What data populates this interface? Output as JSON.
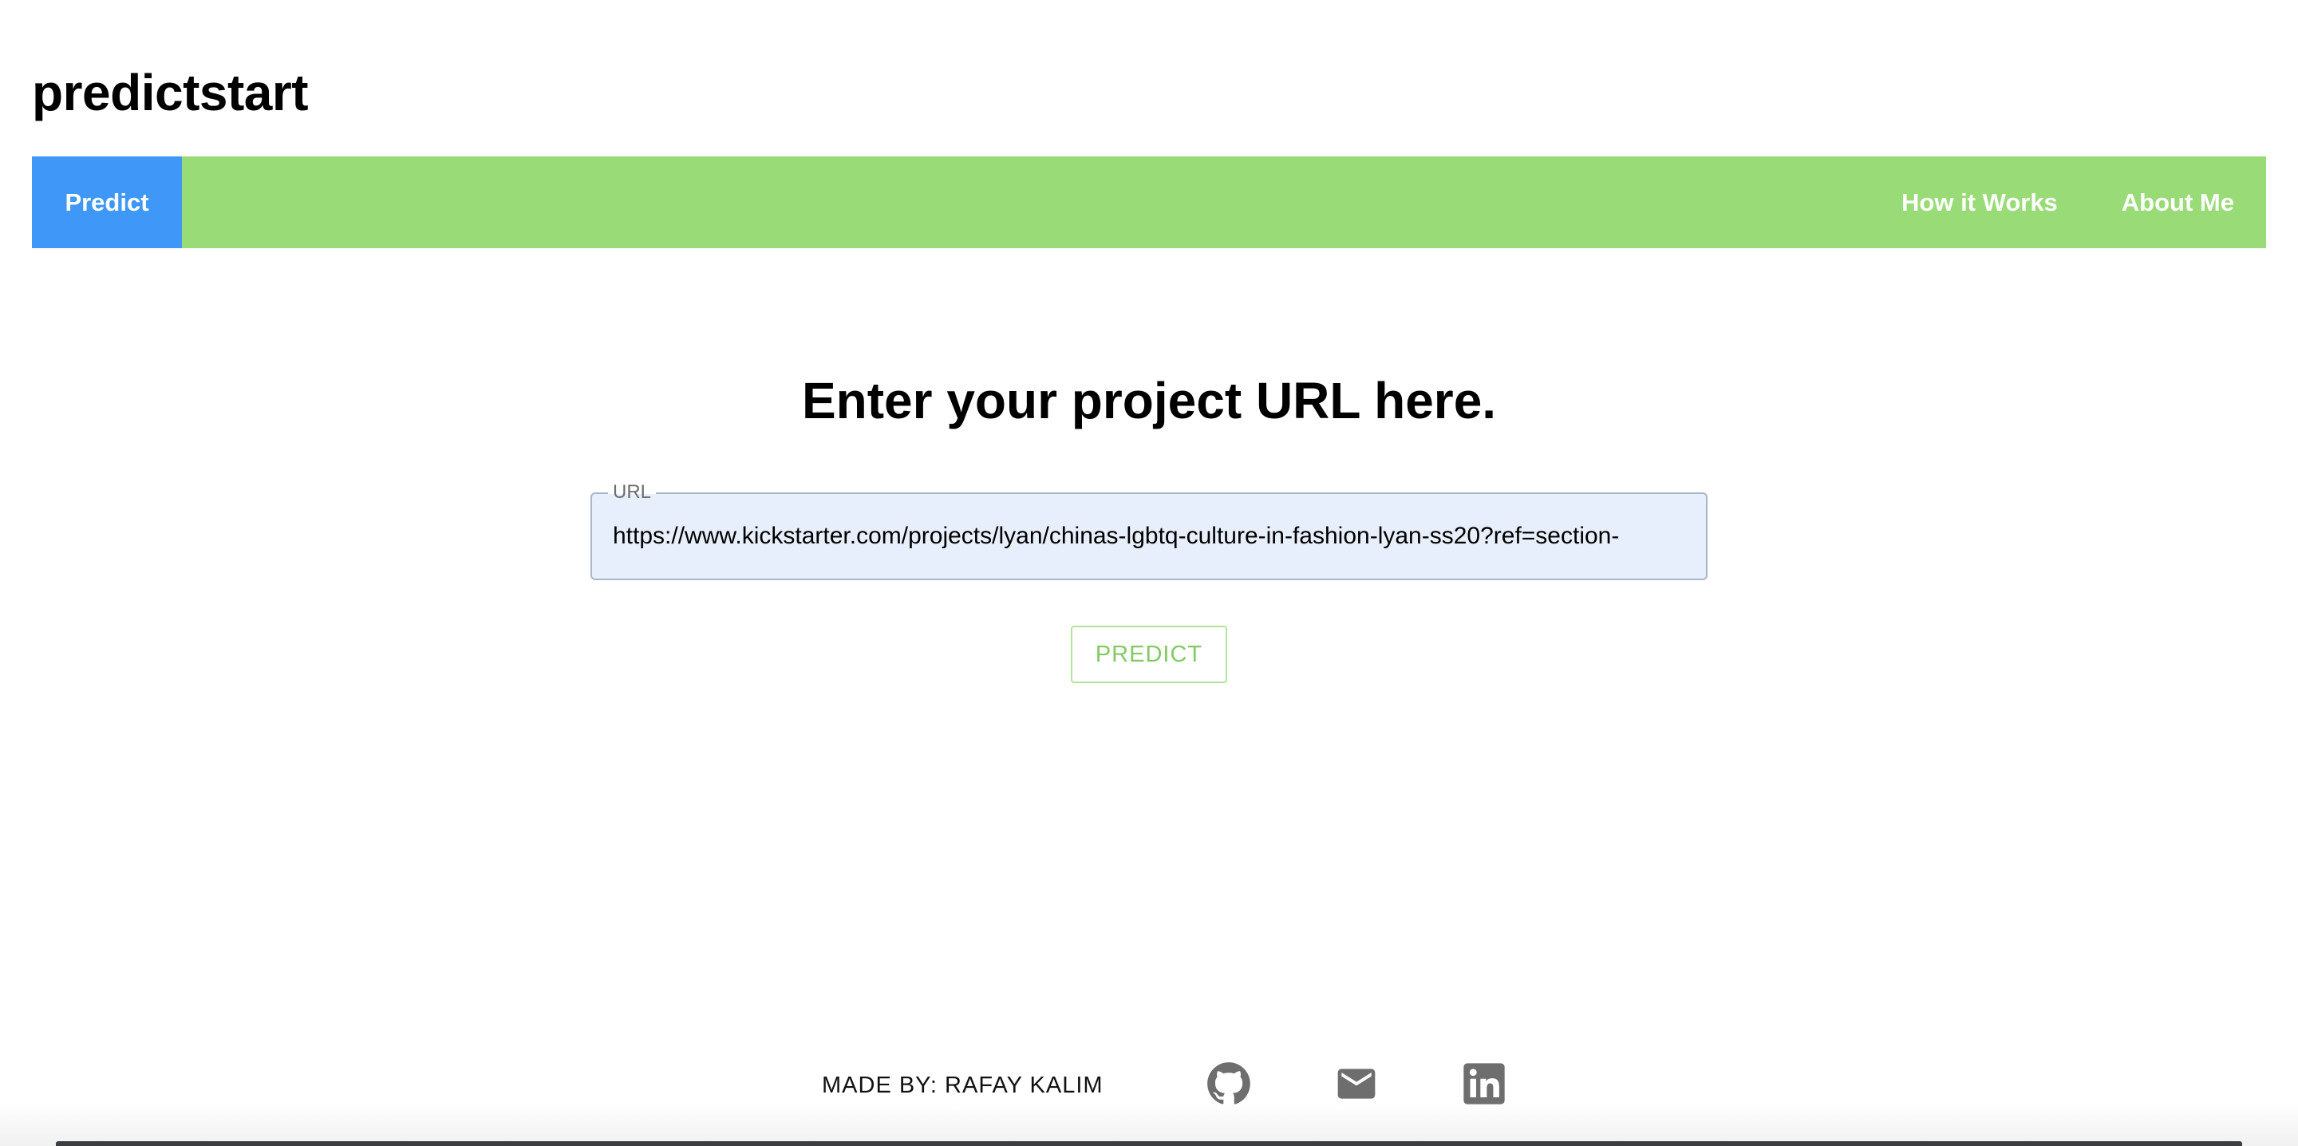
{
  "brand": {
    "title": "predictstart"
  },
  "nav": {
    "predict": "Predict",
    "how_it_works": "How it Works",
    "about_me": "About Me"
  },
  "main": {
    "heading": "Enter your project URL here.",
    "url_label": "URL",
    "url_value": "https://www.kickstarter.com/projects/lyan/chinas-lgbtq-culture-in-fashion-lyan-ss20?ref=section-",
    "predict_button": "PREDICT"
  },
  "footer": {
    "made_by": "MADE BY: RAFAY KALIM",
    "icons": [
      "github-icon",
      "mail-icon",
      "linkedin-icon"
    ]
  },
  "colors": {
    "nav_bg": "#99db77",
    "nav_active": "#3f97f7",
    "input_bg": "#e8effc",
    "button_text": "#84c964",
    "icon_gray": "#6e6e6e"
  }
}
